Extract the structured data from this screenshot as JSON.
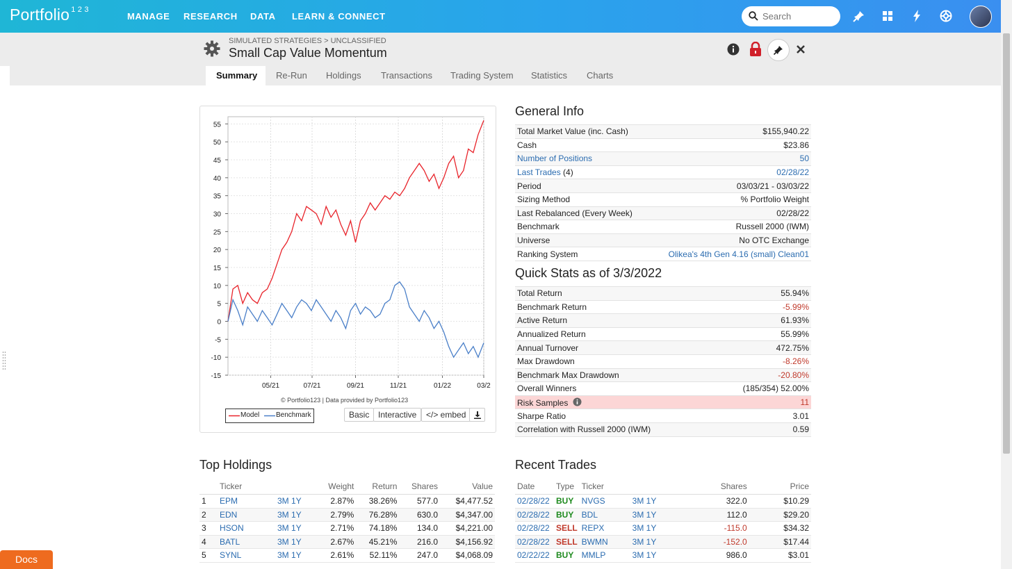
{
  "app": {
    "logo": "Portfolio",
    "logo_sup": "1 2 3",
    "nav": [
      "MANAGE",
      "RESEARCH",
      "DATA",
      "LEARN & CONNECT"
    ],
    "search_placeholder": "Search"
  },
  "page": {
    "breadcrumb": "SIMULATED STRATEGIES > UNCLASSIFIED",
    "title": "Small Cap Value Momentum"
  },
  "tabs": [
    "Summary",
    "Re-Run",
    "Holdings",
    "Transactions",
    "Trading System",
    "Statistics",
    "Charts"
  ],
  "chart": {
    "credit": "© Portfolio123 | Data provided by Portfolio123",
    "legend_model": "Model",
    "legend_benchmark": "Benchmark",
    "buttons": [
      "Basic",
      "Interactive",
      "</> embed"
    ]
  },
  "chart_data": {
    "type": "line",
    "title": "",
    "xlabel": "",
    "ylabel": "",
    "x_ticks": [
      "05/21",
      "07/21",
      "09/21",
      "11/21",
      "01/22",
      "03/2"
    ],
    "y_ticks": [
      55,
      50,
      45,
      40,
      35,
      30,
      25,
      20,
      15,
      10,
      5,
      0,
      -5,
      -10,
      -15
    ],
    "ylim": [
      -15,
      57
    ],
    "x_range": [
      "2021-03-03",
      "2022-03-03"
    ],
    "series": [
      {
        "name": "Model",
        "color": "#e8232a",
        "x": [
          "2021-03-03",
          "2021-03-10",
          "2021-03-17",
          "2021-03-24",
          "2021-03-31",
          "2021-04-07",
          "2021-04-14",
          "2021-04-21",
          "2021-04-28",
          "2021-05-05",
          "2021-05-12",
          "2021-05-19",
          "2021-05-26",
          "2021-06-02",
          "2021-06-09",
          "2021-06-16",
          "2021-06-23",
          "2021-06-30",
          "2021-07-07",
          "2021-07-14",
          "2021-07-21",
          "2021-07-28",
          "2021-08-04",
          "2021-08-11",
          "2021-08-18",
          "2021-08-25",
          "2021-09-01",
          "2021-09-08",
          "2021-09-15",
          "2021-09-22",
          "2021-09-29",
          "2021-10-06",
          "2021-10-13",
          "2021-10-20",
          "2021-10-27",
          "2021-11-03",
          "2021-11-10",
          "2021-11-17",
          "2021-11-24",
          "2021-12-01",
          "2021-12-08",
          "2021-12-15",
          "2021-12-22",
          "2021-12-29",
          "2022-01-05",
          "2022-01-12",
          "2022-01-19",
          "2022-01-26",
          "2022-02-02",
          "2022-02-09",
          "2022-02-16",
          "2022-02-23",
          "2022-03-03"
        ],
        "y": [
          0,
          9,
          10,
          5,
          8,
          6,
          5,
          8,
          9,
          12,
          16,
          20,
          22,
          25,
          30,
          28,
          32,
          31,
          30,
          27,
          32,
          29,
          31,
          27,
          24,
          28,
          22,
          28,
          30,
          33,
          31,
          33,
          35,
          34,
          36,
          35,
          37,
          40,
          42,
          44,
          42,
          39,
          41,
          37,
          40,
          44,
          46,
          40,
          42,
          48,
          47,
          52,
          56
        ]
      },
      {
        "name": "Benchmark",
        "color": "#4a7fc8",
        "x": [
          "2021-03-03",
          "2021-03-10",
          "2021-03-17",
          "2021-03-24",
          "2021-03-31",
          "2021-04-07",
          "2021-04-14",
          "2021-04-21",
          "2021-04-28",
          "2021-05-05",
          "2021-05-12",
          "2021-05-19",
          "2021-05-26",
          "2021-06-02",
          "2021-06-09",
          "2021-06-16",
          "2021-06-23",
          "2021-06-30",
          "2021-07-07",
          "2021-07-14",
          "2021-07-21",
          "2021-07-28",
          "2021-08-04",
          "2021-08-11",
          "2021-08-18",
          "2021-08-25",
          "2021-09-01",
          "2021-09-08",
          "2021-09-15",
          "2021-09-22",
          "2021-09-29",
          "2021-10-06",
          "2021-10-13",
          "2021-10-20",
          "2021-10-27",
          "2021-11-03",
          "2021-11-10",
          "2021-11-17",
          "2021-11-24",
          "2021-12-01",
          "2021-12-08",
          "2021-12-15",
          "2021-12-22",
          "2021-12-29",
          "2022-01-05",
          "2022-01-12",
          "2022-01-19",
          "2022-01-26",
          "2022-02-02",
          "2022-02-09",
          "2022-02-16",
          "2022-02-23",
          "2022-03-03"
        ],
        "y": [
          0,
          6,
          3,
          -1,
          4,
          2,
          0,
          3,
          1,
          -1,
          2,
          5,
          3,
          1,
          4,
          6,
          5,
          3,
          6,
          4,
          2,
          0,
          3,
          1,
          -2,
          3,
          5,
          2,
          4,
          3,
          1,
          2,
          5,
          6,
          10,
          11,
          9,
          4,
          2,
          0,
          3,
          1,
          -2,
          0,
          -3,
          -7,
          -10,
          -8,
          -6,
          -9,
          -7,
          -10,
          -6
        ]
      }
    ]
  },
  "general_info": {
    "heading": "General Info",
    "rows": [
      {
        "label": "Total Market Value (inc. Cash)",
        "value": "$155,940.22"
      },
      {
        "label": "Cash",
        "value": "$23.86"
      },
      {
        "label": "Number of Positions",
        "value": "50",
        "link": true
      },
      {
        "label": "Last Trades",
        "label_suffix": " (4)",
        "value": "02/28/22",
        "link": true
      },
      {
        "label": "Period",
        "value": "03/03/21 - 03/03/22"
      },
      {
        "label": "Sizing Method",
        "value": "% Portfolio Weight"
      },
      {
        "label": "Last Rebalanced (Every Week)",
        "value": "02/28/22"
      },
      {
        "label": "Benchmark",
        "value": "Russell 2000 (IWM)"
      },
      {
        "label": "Universe",
        "value": "No OTC Exchange"
      },
      {
        "label": "Ranking System",
        "value": "Olikea's 4th Gen 4.16 (small) Clean01",
        "value_link": true
      }
    ]
  },
  "quick_stats": {
    "heading": "Quick Stats as of 3/3/2022",
    "rows": [
      {
        "label": "Total Return",
        "value": "55.94%"
      },
      {
        "label": "Benchmark Return",
        "value": "-5.99%",
        "neg": true
      },
      {
        "label": "Active Return",
        "value": "61.93%"
      },
      {
        "label": "Annualized Return",
        "value": "55.99%"
      },
      {
        "label": "Annual Turnover",
        "value": "472.75%"
      },
      {
        "label": "Max Drawdown",
        "value": "-8.26%",
        "neg": true
      },
      {
        "label": "Benchmark Max Drawdown",
        "value": "-20.80%",
        "neg": true
      },
      {
        "label": "Overall Winners",
        "value": "(185/354) 52.00%"
      },
      {
        "label": "Risk Samples",
        "value": "11",
        "risk": true
      },
      {
        "label": "Sharpe Ratio",
        "value": "3.01"
      },
      {
        "label": "Correlation with Russell 2000 (IWM)",
        "value": "0.59"
      }
    ]
  },
  "top_holdings": {
    "heading": "Top Holdings",
    "columns": [
      "",
      "Ticker",
      "",
      "Weight",
      "Return",
      "Shares",
      "Value"
    ],
    "period_links": "3M 1Y",
    "rows": [
      {
        "n": "1",
        "ticker": "EPM",
        "weight": "2.87%",
        "ret": "38.26%",
        "shares": "577.0",
        "value": "$4,477.52"
      },
      {
        "n": "2",
        "ticker": "EDN",
        "weight": "2.79%",
        "ret": "76.28%",
        "shares": "630.0",
        "value": "$4,347.00"
      },
      {
        "n": "3",
        "ticker": "HSON",
        "weight": "2.71%",
        "ret": "74.18%",
        "shares": "134.0",
        "value": "$4,221.00"
      },
      {
        "n": "4",
        "ticker": "BATL",
        "weight": "2.67%",
        "ret": "45.21%",
        "shares": "216.0",
        "value": "$4,156.92"
      },
      {
        "n": "5",
        "ticker": "SYNL",
        "weight": "2.61%",
        "ret": "52.11%",
        "shares": "247.0",
        "value": "$4,068.09"
      }
    ]
  },
  "recent_trades": {
    "heading": "Recent Trades",
    "columns": [
      "Date",
      "Type",
      "Ticker",
      "",
      "Shares",
      "Price"
    ],
    "period_links": "3M 1Y",
    "rows": [
      {
        "date": "02/28/22",
        "type": "BUY",
        "ticker": "NVGS",
        "shares": "322.0",
        "price": "$10.29"
      },
      {
        "date": "02/28/22",
        "type": "BUY",
        "ticker": "BDL",
        "shares": "112.0",
        "price": "$29.20"
      },
      {
        "date": "02/28/22",
        "type": "SELL",
        "ticker": "REPX",
        "shares": "-115.0",
        "price": "$34.32"
      },
      {
        "date": "02/28/22",
        "type": "SELL",
        "ticker": "BWMN",
        "shares": "-152.0",
        "price": "$17.44"
      },
      {
        "date": "02/22/22",
        "type": "BUY",
        "ticker": "MMLP",
        "shares": "986.0",
        "price": "$3.01"
      }
    ]
  },
  "docs_label": "Docs"
}
